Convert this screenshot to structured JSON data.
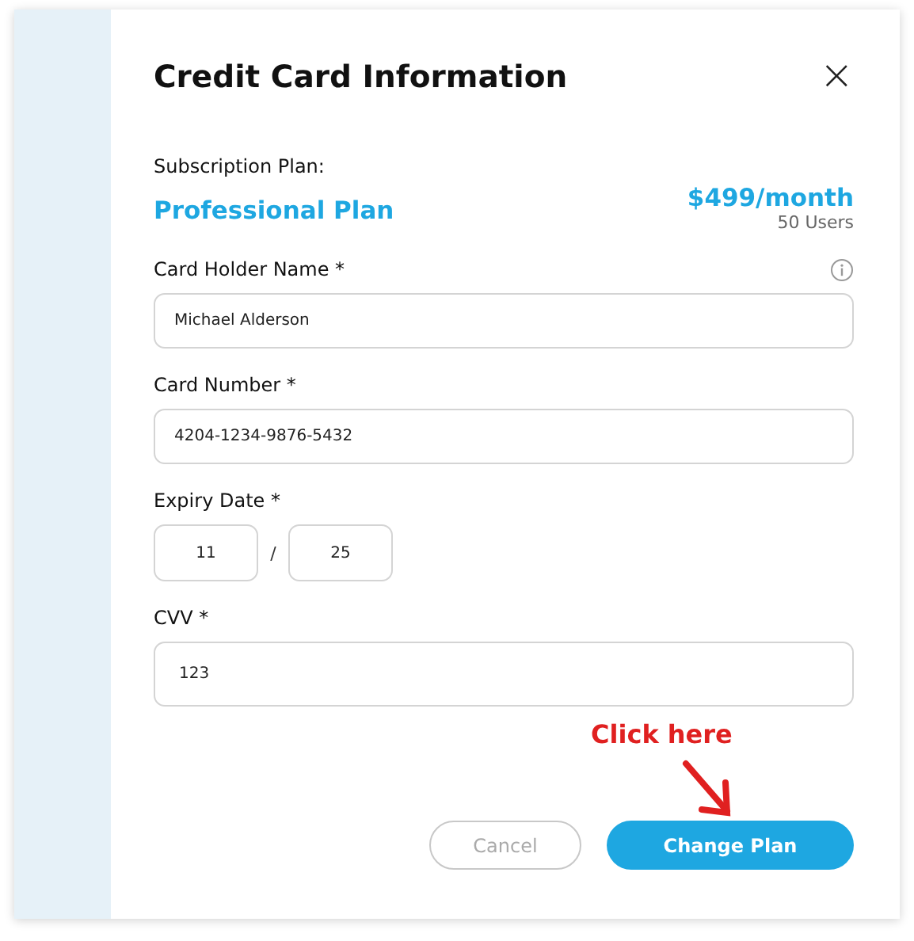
{
  "dialog": {
    "title": "Credit Card Information",
    "close": "×"
  },
  "plan": {
    "label": "Subscription Plan:",
    "name": "Professional Plan",
    "price": "$499/month",
    "users": "50 Users"
  },
  "fields": [
    {
      "kind": "text",
      "label": "Card Holder Name *",
      "value": "Michael Alderson",
      "info": true
    },
    {
      "kind": "text",
      "label": "Card Number *",
      "value": "4204-1234-9876-5432",
      "info": false
    },
    {
      "kind": "expiry",
      "label": "Expiry Date *",
      "month": "11",
      "separator": "/",
      "year": "25",
      "info": false
    },
    {
      "kind": "tall",
      "label": "CVV *",
      "value": "123",
      "info": false
    }
  ],
  "buttons": [
    {
      "label": "Cancel",
      "kind": "secondary"
    },
    {
      "label": "Change Plan",
      "kind": "primary"
    }
  ],
  "annotation": {
    "text": "Click here"
  }
}
